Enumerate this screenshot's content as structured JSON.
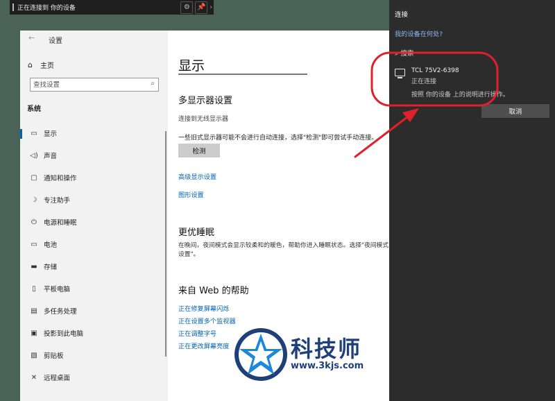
{
  "topbar": {
    "title": "正在连接到 你的设备",
    "settings_icon": "gear-icon",
    "pin_icon": "pin-icon"
  },
  "settings": {
    "app_title": "设置",
    "home_label": "主页",
    "search_placeholder": "查找设置",
    "section_label": "系统",
    "nav_items": [
      {
        "label": "显示",
        "icon": "monitor-icon"
      },
      {
        "label": "声音",
        "icon": "speaker-icon"
      },
      {
        "label": "通知和操作",
        "icon": "notification-icon"
      },
      {
        "label": "专注助手",
        "icon": "moon-icon"
      },
      {
        "label": "电源和睡眠",
        "icon": "power-icon"
      },
      {
        "label": "电池",
        "icon": "battery-icon"
      },
      {
        "label": "存储",
        "icon": "storage-icon"
      },
      {
        "label": "平板电脑",
        "icon": "tablet-icon"
      },
      {
        "label": "多任务处理",
        "icon": "multitask-icon"
      },
      {
        "label": "投影到此电脑",
        "icon": "project-icon"
      },
      {
        "label": "剪贴板",
        "icon": "clipboard-icon"
      },
      {
        "label": "远程桌面",
        "icon": "remote-desktop-icon"
      }
    ]
  },
  "display": {
    "page_title": "显示",
    "multi_display_heading": "多显示器设置",
    "wireless_connect_label": "连接到无线显示器",
    "detect_note": "一些旧式显示器可能不会进行自动连接，选择\"检测\"即可尝试手动连接。",
    "detect_button": "检测",
    "advanced_link": "高级显示设置",
    "graphics_link": "图形设置",
    "sleep_heading": "更优睡眠",
    "sleep_text": "在晚间，夜间模式会显示较柔和的暖色，帮助你进入睡眠状态。选择\"夜间模式设置\"。",
    "help_heading": "来自 Web 的帮助",
    "help_links": [
      "正在修复屏幕闪烁",
      "正在设置多个监视器",
      "正在调整字号",
      "正在更改屏幕亮度"
    ]
  },
  "connect_pane": {
    "title": "连接",
    "where_link": "我的设备在何处?",
    "searching": "搜索",
    "device_name": "TCL 75V2-6398",
    "device_status": "正在连接",
    "device_instruction": "按照 你的设备 上的说明进行操作。",
    "cancel_button": "取消"
  },
  "watermark": {
    "brand": "科技师",
    "url": "www.3kjs.com"
  },
  "colors": {
    "desktop": "#4a6358",
    "accent": "#0063b1",
    "annotation": "#e0202a",
    "watermark": "#1f3f78"
  }
}
